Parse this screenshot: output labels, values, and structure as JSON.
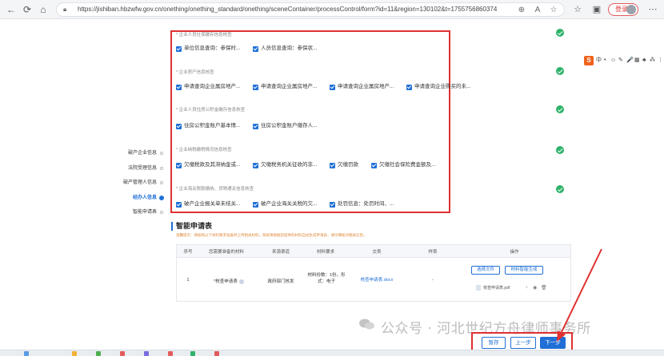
{
  "browser": {
    "url": "https://jishiban.hbzwfw.gov.cn/onething/onething_standard/onething/sceneContainer/processControl/form?id=11&region=130102&t=1755756860374",
    "login_label": "登录"
  },
  "left_nav": {
    "items": [
      {
        "label": "破产企业信息",
        "active": false
      },
      {
        "label": "法院受理信息",
        "active": false
      },
      {
        "label": "破产管理人信息",
        "active": false
      },
      {
        "label": "经办人信息",
        "active": true
      },
      {
        "label": "智能申请表",
        "active": false
      }
    ]
  },
  "sections": [
    {
      "title": "* 企业人员社保缴存信息核查",
      "items": [
        "单位信息查询：参保时...",
        "人员信息查询：参保状..."
      ]
    },
    {
      "title": "* 企业房产信息核查",
      "items": [
        "申请查询企业属房地产...",
        "申请查询企业属房地产...",
        "申请查询企业属房地产...",
        "申请查询企业购买的未..."
      ]
    },
    {
      "title": "* 企业人员住房公积金缴存信息核查",
      "items": [
        "住房公积金账户基本情...",
        "住房公积金账户缴存人..."
      ]
    },
    {
      "title": "* 企业纳税缴税情况信息核查",
      "items": [
        "欠缴税款及其滞纳金或...",
        "欠缴税务机关征收的非...",
        "欠缴罚款",
        "欠缴社会保险费金额及..."
      ]
    },
    {
      "title": "* 企业海关税款缴纳、货物通关信息核查",
      "items": [
        "破产企业报关单未结关...",
        "破产企业海关关税的欠...",
        "处罚信息：处罚时间、..."
      ]
    }
  ],
  "ime": {
    "logo": "S",
    "items": [
      "中",
      "•",
      "☺",
      "✎",
      "🎤",
      "▦",
      "♣",
      "⁂",
      "⋮"
    ]
  },
  "form": {
    "heading": "智能申请表",
    "note": "温馨提示：请按照以下材料要求准备并上传相关材料，系统将根据您提供的材料自动生成申请表，请仔细核对相关信息。",
    "columns": [
      "序号",
      "您需要准备的材料",
      "来源渠道",
      "材料要求",
      "交表",
      "样表",
      "操作"
    ],
    "rows": [
      {
        "index": "1",
        "material": "*核查申请表",
        "source": "政府部门核发",
        "requirement": "材料份数：1份，形式：电子",
        "template": "核查申请表.docx",
        "sample": "-",
        "op_select": "选择文件",
        "op_generate": "材料智能生成",
        "file_name": "核查申请表.pdf"
      }
    ]
  },
  "watermark": "公众号 · 河北世纪方舟律师事务所",
  "buttons": {
    "save": "暂存",
    "prev": "上一步",
    "next": "下一步"
  },
  "colors": {
    "accent": "#1f6fd6",
    "highlight": "#e03131",
    "success": "#2fb36b"
  },
  "icons": {
    "back": "back-icon",
    "refresh": "refresh-icon",
    "home": "home-icon",
    "lock": "lock-icon",
    "zoom": "zoom-icon",
    "read_aloud": "read-aloud-icon",
    "favorite": "star-icon",
    "favorites": "favorites-icon",
    "extension": "extension-icon",
    "help": "help-icon",
    "download": "download-icon",
    "view": "eye-icon",
    "delete": "trash-icon"
  }
}
